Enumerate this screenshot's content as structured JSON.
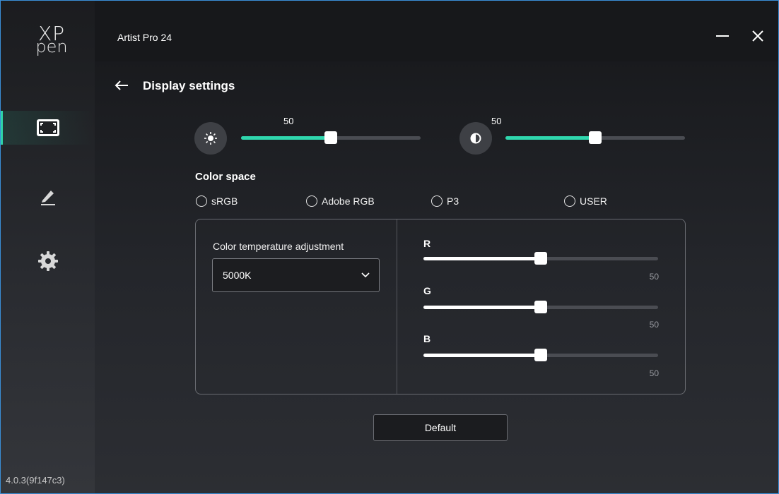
{
  "logo": {
    "line1": "XP",
    "line2": "pen"
  },
  "sidebar": {
    "items": [
      {
        "name": "display",
        "icon": "display-frame-icon",
        "active": true
      },
      {
        "name": "pen",
        "icon": "pen-icon",
        "active": false
      },
      {
        "name": "settings",
        "icon": "gear-icon",
        "active": false
      }
    ],
    "version": "4.0.3(9f147c3)"
  },
  "window": {
    "title": "Artist Pro 24",
    "minimize_icon": "minimize-icon",
    "close_icon": "close-icon"
  },
  "page": {
    "back_icon": "arrow-left-icon",
    "title": "Display settings"
  },
  "brightness": {
    "icon": "sun-icon",
    "value": "50",
    "level": 0.5
  },
  "contrast": {
    "icon": "contrast-icon",
    "value": "50",
    "level": 0.5
  },
  "color_space": {
    "title": "Color space",
    "options": [
      "sRGB",
      "Adobe RGB",
      "P3",
      "USER"
    ],
    "selected": null
  },
  "temperature": {
    "label": "Color temperature adjustment",
    "selected": "5000K",
    "chevron_icon": "chevron-down-icon"
  },
  "channels": [
    {
      "label": "R",
      "value": "50",
      "level": 0.5
    },
    {
      "label": "G",
      "value": "50",
      "level": 0.5
    },
    {
      "label": "B",
      "value": "50",
      "level": 0.5
    }
  ],
  "default_button": "Default",
  "colors": {
    "accent": "#2fd6ad",
    "window_border": "#3a8fd8",
    "background": "#1e1f23"
  }
}
